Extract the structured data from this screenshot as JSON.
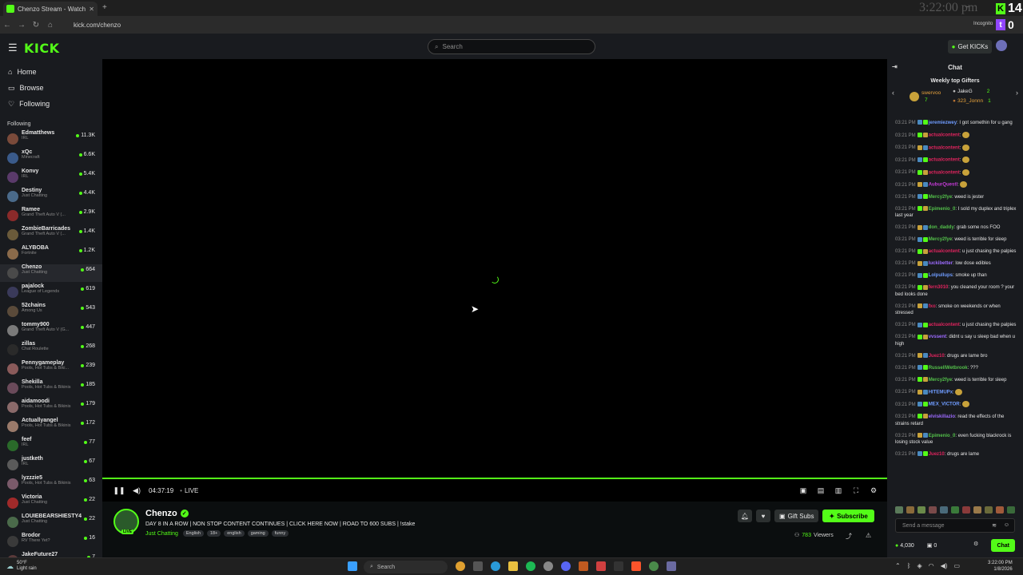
{
  "browser": {
    "tab_title": "Chenzo Stream - Watch Li...",
    "url": "kick.com/chenzo",
    "incognito_label": "Incognito",
    "overlay_clock": "3:22:00 pm",
    "k_count": "14",
    "twitch_count": "0"
  },
  "header": {
    "logo": "KICK",
    "search_placeholder": "Search",
    "get_kicks_label": "Get KICKs"
  },
  "sidebar": {
    "nav": [
      {
        "label": "Home",
        "icon": "home-icon"
      },
      {
        "label": "Browse",
        "icon": "browse-icon"
      },
      {
        "label": "Following",
        "icon": "heart-icon"
      }
    ],
    "following_title": "Following",
    "channels": [
      {
        "name": "Edmatthews",
        "category": "IRL",
        "viewers": "11.3K",
        "color": "#7a4a3a"
      },
      {
        "name": "xQc",
        "category": "Minecraft",
        "viewers": "6.6K",
        "color": "#3a5a8a"
      },
      {
        "name": "Konvy",
        "category": "IRL",
        "viewers": "5.4K",
        "color": "#5a3a6a"
      },
      {
        "name": "Destiny",
        "category": "Just Chatting",
        "viewers": "4.4K",
        "color": "#4a6a8a"
      },
      {
        "name": "Ramee",
        "category": "Grand Theft Auto V (...",
        "viewers": "2.9K",
        "color": "#8a2a2a"
      },
      {
        "name": "ZombieBarricades",
        "category": "Grand Theft Auto V (...",
        "viewers": "1.4K",
        "color": "#6a5a3a"
      },
      {
        "name": "ALYBOBA",
        "category": "Fortnite",
        "viewers": "1.2K",
        "color": "#8a6a4a"
      },
      {
        "name": "Chenzo",
        "category": "Just Chatting",
        "viewers": "664",
        "color": "#4a4a4a"
      },
      {
        "name": "pajalock",
        "category": "League of Legends",
        "viewers": "619",
        "color": "#3a3a5a"
      },
      {
        "name": "52chains",
        "category": "Among Us",
        "viewers": "543",
        "color": "#5a4a3a"
      },
      {
        "name": "tommy900",
        "category": "Grand Theft Auto V (G...",
        "viewers": "447",
        "color": "#7a7a7a"
      },
      {
        "name": "zillas",
        "category": "Chat Roulette",
        "viewers": "268",
        "color": "#2a2a2a"
      },
      {
        "name": "Pennygameplay",
        "category": "Pools, Hot Tubs & Biki...",
        "viewers": "239",
        "color": "#8a5a5a"
      },
      {
        "name": "Shekilla",
        "category": "Pools, Hot Tubs & Bikinis",
        "viewers": "185",
        "color": "#6a4a5a"
      },
      {
        "name": "aidamoodi",
        "category": "Pools, Hot Tubs & Bikinis",
        "viewers": "179",
        "color": "#8a6a6a"
      },
      {
        "name": "Actuallyangel",
        "category": "Pools, Hot Tubs & Bikinis",
        "viewers": "172",
        "color": "#9a7a6a"
      },
      {
        "name": "feef",
        "category": "IRL",
        "viewers": "77",
        "color": "#2a6a2a"
      },
      {
        "name": "justketh",
        "category": "IRL",
        "viewers": "67",
        "color": "#5a5a5a"
      },
      {
        "name": "lyzzzie5",
        "category": "Pools, Hot Tubs & Bikinis",
        "viewers": "63",
        "color": "#7a5a6a"
      },
      {
        "name": "Victoria",
        "category": "Just Chatting",
        "viewers": "22",
        "color": "#a02a2a"
      },
      {
        "name": "LOUIEBEARSHIESTY4",
        "category": "Just Chatting",
        "viewers": "22",
        "color": "#4a6a4a"
      },
      {
        "name": "Brodor",
        "category": "RV There Yet?",
        "viewers": "16",
        "color": "#3a3a3a"
      },
      {
        "name": "JakeFuture27",
        "category": "Just Chatting",
        "viewers": "7",
        "color": "#5a3a3a"
      },
      {
        "name": "aircool",
        "category": "Just Chatting",
        "viewers": "6",
        "color": "#6a6a8a"
      }
    ]
  },
  "player": {
    "time": "04:37:19",
    "live_label": "LIVE"
  },
  "stream": {
    "streamer": "Chenzo",
    "live_badge": "LIVE",
    "title": "DAY 8 IN A ROW | NON STOP CONTENT CONTINUES | CLICK HERE NOW | ROAD TO 600 SUBS | !stake",
    "category": "Just Chatting",
    "tags": [
      "English",
      "18+",
      "english",
      "gaming",
      "funny"
    ],
    "gift_subs_label": "Gift Subs",
    "subscribe_label": "Subscribe",
    "viewers": "783",
    "viewers_label": "Viewers"
  },
  "chat": {
    "title": "Chat",
    "gifters_title": "Weekly top Gifters",
    "gifters": [
      {
        "name": "swervoo",
        "count": "7"
      },
      {
        "name": "JakeG",
        "count": "2"
      },
      {
        "name": "323_Jonnn",
        "count": "1"
      }
    ],
    "messages": [
      {
        "time": "03:21 PM",
        "user": "jeremiezwey",
        "color": "#6f9cff",
        "text": "I got somethin for u gang"
      },
      {
        "time": "03:21 PM",
        "user": "actualcontent",
        "color": "#e0245e",
        "text": ""
      },
      {
        "time": "03:21 PM",
        "user": "actualcontent",
        "color": "#e0245e",
        "text": ""
      },
      {
        "time": "03:21 PM",
        "user": "actualcontent",
        "color": "#e0245e",
        "text": ""
      },
      {
        "time": "03:21 PM",
        "user": "actualcontent",
        "color": "#e0245e",
        "text": ""
      },
      {
        "time": "03:21 PM",
        "user": "AuburQuestl",
        "color": "#c43bd6",
        "text": ""
      },
      {
        "time": "03:21 PM",
        "user": "Mercy2fye",
        "color": "#53c04a",
        "text": "weed is jester"
      },
      {
        "time": "03:21 PM",
        "user": "Epimenio_0",
        "color": "#53c04a",
        "text": "I sold my duplex and triplex last year"
      },
      {
        "time": "03:21 PM",
        "user": "don_daddy",
        "color": "#53c04a",
        "text": "grab some nos FOO"
      },
      {
        "time": "03:21 PM",
        "user": "Mercy2fye",
        "color": "#53c04a",
        "text": "weed is terrible for sleep"
      },
      {
        "time": "03:21 PM",
        "user": "actualcontent",
        "color": "#e0245e",
        "text": "u just chasing the palpies"
      },
      {
        "time": "03:21 PM",
        "user": "luckibetter",
        "color": "#9d6bff",
        "text": "low dose edibles"
      },
      {
        "time": "03:21 PM",
        "user": "Lolpullups",
        "color": "#6f9cff",
        "text": "smoke up than"
      },
      {
        "time": "03:21 PM",
        "user": "fern3010",
        "color": "#e0245e",
        "text": "you cleaned your room ? your bed looks done"
      },
      {
        "time": "03:21 PM",
        "user": "fxo",
        "color": "#e0245e",
        "text": "smoke on weekends or when stressed"
      },
      {
        "time": "03:21 PM",
        "user": "actualcontent",
        "color": "#e0245e",
        "text": "u just chasing the palpies"
      },
      {
        "time": "03:21 PM",
        "user": "vvssent",
        "color": "#9d6bff",
        "text": "didnt u say u sleep bad when u high"
      },
      {
        "time": "03:21 PM",
        "user": "Juez10",
        "color": "#e0245e",
        "text": "drugs are lame bro"
      },
      {
        "time": "03:21 PM",
        "user": "RussellWetbrook",
        "color": "#53c04a",
        "text": "???"
      },
      {
        "time": "03:21 PM",
        "user": "Mercy2fye",
        "color": "#53c04a",
        "text": "weed is terrible for sleep"
      },
      {
        "time": "03:21 PM",
        "user": "HITEMUPx",
        "color": "#6f9cff",
        "text": ""
      },
      {
        "time": "03:21 PM",
        "user": "MEX_VICTOR",
        "color": "#6f9cff",
        "text": ""
      },
      {
        "time": "03:21 PM",
        "user": "elviskillazio",
        "color": "#9d6bff",
        "text": "read the effects of the strains retard"
      },
      {
        "time": "03:21 PM",
        "user": "Epimenio_0",
        "color": "#53c04a",
        "text": "even fucking blackrock is losing stock value"
      },
      {
        "time": "03:21 PM",
        "user": "Juez10",
        "color": "#e0245e",
        "text": "drugs are lame"
      }
    ],
    "input_placeholder": "Send a message",
    "kicks_count": "4,030",
    "sub_count": "0",
    "chat_button": "Chat"
  },
  "taskbar": {
    "temp": "50°F",
    "weather": "Light rain",
    "search_label": "Search",
    "time": "3:22:00 PM",
    "date": "1/8/2026"
  }
}
